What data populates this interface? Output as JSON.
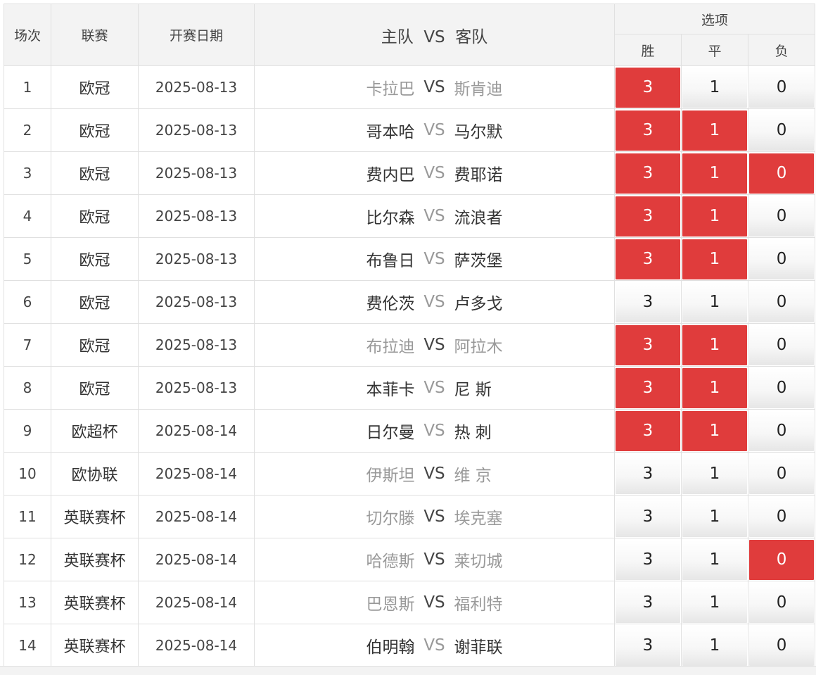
{
  "headers": {
    "index": "场次",
    "league": "联赛",
    "date": "开赛日期",
    "match": "主队  VS  客队",
    "options": "选项",
    "win": "胜",
    "draw": "平",
    "loss": "负"
  },
  "colors": {
    "selected": "#e03c3c",
    "muted_team": "#999999",
    "header_bg": "#f3f3f3"
  },
  "vs_label": "VS",
  "rows": [
    {
      "index": "1",
      "league": "欧冠",
      "date": "2025-08-13",
      "home": "卡拉巴",
      "away": "斯肯迪",
      "muted": true,
      "win": "3",
      "draw": "1",
      "loss": "0",
      "sel": [
        true,
        false,
        false
      ]
    },
    {
      "index": "2",
      "league": "欧冠",
      "date": "2025-08-13",
      "home": "哥本哈",
      "away": "马尔默",
      "muted": false,
      "win": "3",
      "draw": "1",
      "loss": "0",
      "sel": [
        true,
        true,
        false
      ]
    },
    {
      "index": "3",
      "league": "欧冠",
      "date": "2025-08-13",
      "home": "费内巴",
      "away": "费耶诺",
      "muted": false,
      "win": "3",
      "draw": "1",
      "loss": "0",
      "sel": [
        true,
        true,
        true
      ]
    },
    {
      "index": "4",
      "league": "欧冠",
      "date": "2025-08-13",
      "home": "比尔森",
      "away": "流浪者",
      "muted": false,
      "win": "3",
      "draw": "1",
      "loss": "0",
      "sel": [
        true,
        true,
        false
      ]
    },
    {
      "index": "5",
      "league": "欧冠",
      "date": "2025-08-13",
      "home": "布鲁日",
      "away": "萨茨堡",
      "muted": false,
      "win": "3",
      "draw": "1",
      "loss": "0",
      "sel": [
        true,
        true,
        false
      ]
    },
    {
      "index": "6",
      "league": "欧冠",
      "date": "2025-08-13",
      "home": "费伦茨",
      "away": "卢多戈",
      "muted": false,
      "win": "3",
      "draw": "1",
      "loss": "0",
      "sel": [
        false,
        false,
        false
      ]
    },
    {
      "index": "7",
      "league": "欧冠",
      "date": "2025-08-13",
      "home": "布拉迪",
      "away": "阿拉木",
      "muted": true,
      "win": "3",
      "draw": "1",
      "loss": "0",
      "sel": [
        true,
        true,
        false
      ]
    },
    {
      "index": "8",
      "league": "欧冠",
      "date": "2025-08-13",
      "home": "本菲卡",
      "away": "尼 斯",
      "muted": false,
      "win": "3",
      "draw": "1",
      "loss": "0",
      "sel": [
        true,
        true,
        false
      ]
    },
    {
      "index": "9",
      "league": "欧超杯",
      "date": "2025-08-14",
      "home": "日尔曼",
      "away": "热 刺",
      "muted": false,
      "win": "3",
      "draw": "1",
      "loss": "0",
      "sel": [
        true,
        true,
        false
      ]
    },
    {
      "index": "10",
      "league": "欧协联",
      "date": "2025-08-14",
      "home": "伊斯坦",
      "away": "维 京",
      "muted": true,
      "win": "3",
      "draw": "1",
      "loss": "0",
      "sel": [
        false,
        false,
        false
      ]
    },
    {
      "index": "11",
      "league": "英联赛杯",
      "date": "2025-08-14",
      "home": "切尔滕",
      "away": "埃克塞",
      "muted": true,
      "win": "3",
      "draw": "1",
      "loss": "0",
      "sel": [
        false,
        false,
        false
      ]
    },
    {
      "index": "12",
      "league": "英联赛杯",
      "date": "2025-08-14",
      "home": "哈德斯",
      "away": "莱切城",
      "muted": true,
      "win": "3",
      "draw": "1",
      "loss": "0",
      "sel": [
        false,
        false,
        true
      ]
    },
    {
      "index": "13",
      "league": "英联赛杯",
      "date": "2025-08-14",
      "home": "巴恩斯",
      "away": "福利特",
      "muted": true,
      "win": "3",
      "draw": "1",
      "loss": "0",
      "sel": [
        false,
        false,
        false
      ]
    },
    {
      "index": "14",
      "league": "英联赛杯",
      "date": "2025-08-14",
      "home": "伯明翰",
      "away": "谢菲联",
      "muted": false,
      "win": "3",
      "draw": "1",
      "loss": "0",
      "sel": [
        false,
        false,
        false
      ]
    }
  ]
}
